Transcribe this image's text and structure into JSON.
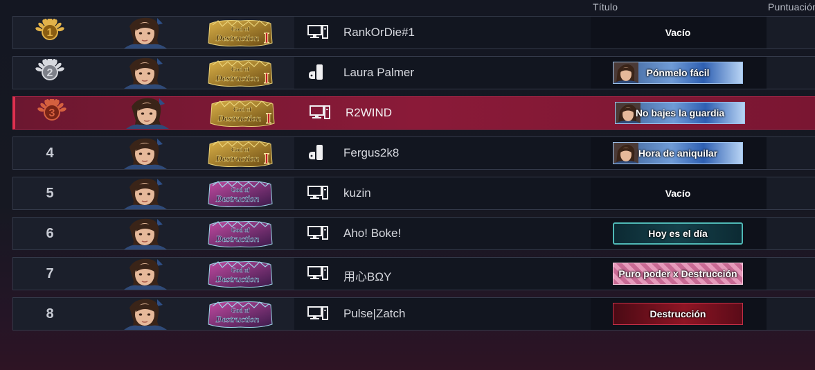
{
  "header": {
    "title_col": "Título",
    "score_col": "Puntuación"
  },
  "colors": {
    "highlight": "#8a1a38",
    "row_bg": "#1b1f2b",
    "gold": "#c9972f",
    "silver": "#b9bcc4",
    "bronze": "#b0442c"
  },
  "rows": [
    {
      "rank": "1",
      "medal": "gold",
      "avatar": "player-avatar-icon",
      "badge": "god-of-destruction-gold-icon",
      "platform": "pc-icon",
      "name": "RankOrDie#1",
      "title": "Vacío",
      "title_style": "empty"
    },
    {
      "rank": "2",
      "medal": "silver",
      "avatar": "player-avatar-icon",
      "badge": "god-of-destruction-gold-icon",
      "platform": "playstation-icon",
      "name": "Laura Palmer",
      "title": "Pónmelo fácil",
      "title_style": "blue"
    },
    {
      "rank": "3",
      "medal": "bronze",
      "avatar": "player-avatar-icon",
      "badge": "god-of-destruction-gold-icon",
      "platform": "pc-icon",
      "name": "R2WIND",
      "title": "No bajes la guardia",
      "title_style": "blue",
      "highlighted": true
    },
    {
      "rank": "4",
      "medal": "",
      "avatar": "player-avatar-icon",
      "badge": "god-of-destruction-gold-icon",
      "platform": "playstation-icon",
      "name": "Fergus2k8",
      "title": "Hora de aniquilar",
      "title_style": "blue"
    },
    {
      "rank": "5",
      "medal": "",
      "avatar": "player-avatar-icon",
      "badge": "god-of-destruction-purple-icon",
      "platform": "pc-icon",
      "name": "kuzin",
      "title": "Vacío",
      "title_style": "empty"
    },
    {
      "rank": "6",
      "medal": "",
      "avatar": "player-avatar-icon",
      "badge": "god-of-destruction-purple-icon",
      "platform": "pc-icon",
      "name": "Aho! Boke!",
      "title": "Hoy es el día",
      "title_style": "teal"
    },
    {
      "rank": "7",
      "medal": "",
      "avatar": "player-avatar-icon",
      "badge": "god-of-destruction-purple-icon",
      "platform": "pc-icon",
      "name": "用心BΩY",
      "title": "Puro poder x Destrucción",
      "title_style": "pink"
    },
    {
      "rank": "8",
      "medal": "",
      "avatar": "player-avatar-icon",
      "badge": "god-of-destruction-purple-icon",
      "platform": "pc-icon",
      "name": "Pulse|Zatch",
      "title": "Destrucción",
      "title_style": "red"
    }
  ]
}
